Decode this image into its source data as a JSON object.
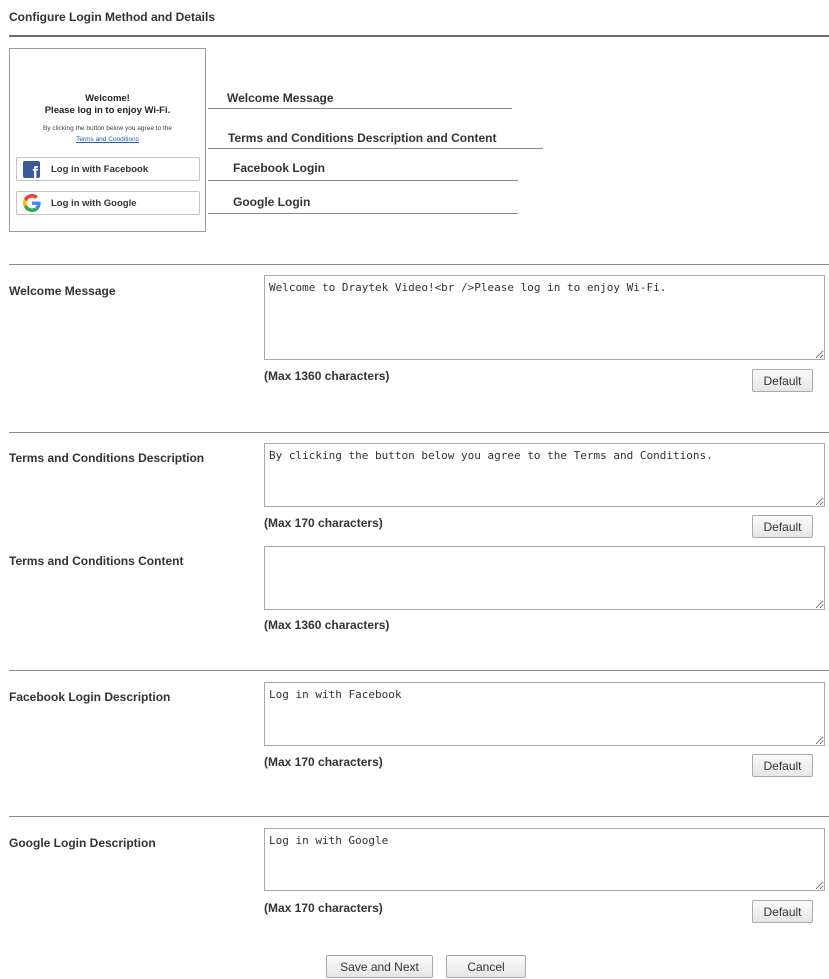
{
  "page_title": "Configure Login Method and Details",
  "preview": {
    "welcome_line1": "Welcome!",
    "welcome_line2": "Please log in to enjoy Wi-Fi.",
    "agree_text": "By clicking the button below you agree to the",
    "terms_link": "Terms and Conditions",
    "facebook_button": "Log in with Facebook",
    "google_button": "Log in with Google"
  },
  "callouts": {
    "welcome": "Welcome Message",
    "terms": "Terms and Conditions Description and Content",
    "facebook": "Facebook Login",
    "google": "Google Login"
  },
  "form": {
    "welcome_message": {
      "label": "Welcome Message",
      "value": "Welcome to Draytek Video!<br />Please log in to enjoy Wi-Fi.",
      "max": "(Max 1360 characters)",
      "default_label": "Default"
    },
    "terms_description": {
      "label": "Terms and Conditions Description",
      "value": "By clicking the button below you agree to the Terms and Conditions.",
      "max": "(Max 170 characters)",
      "default_label": "Default"
    },
    "terms_content": {
      "label": "Terms and Conditions Content",
      "value": "",
      "max": "(Max 1360 characters)"
    },
    "facebook_description": {
      "label": "Facebook Login Description",
      "value": "Log in with Facebook",
      "max": "(Max 170 characters)",
      "default_label": "Default"
    },
    "google_description": {
      "label": "Google Login Description",
      "value": "Log in with Google",
      "max": "(Max 170 characters)",
      "default_label": "Default"
    }
  },
  "actions": {
    "save_label": "Save and Next",
    "cancel_label": "Cancel"
  },
  "colors": {
    "facebook_brand": "#3b5998",
    "link": "#1a5fb4"
  },
  "icons": [
    "facebook-icon",
    "google-icon"
  ]
}
